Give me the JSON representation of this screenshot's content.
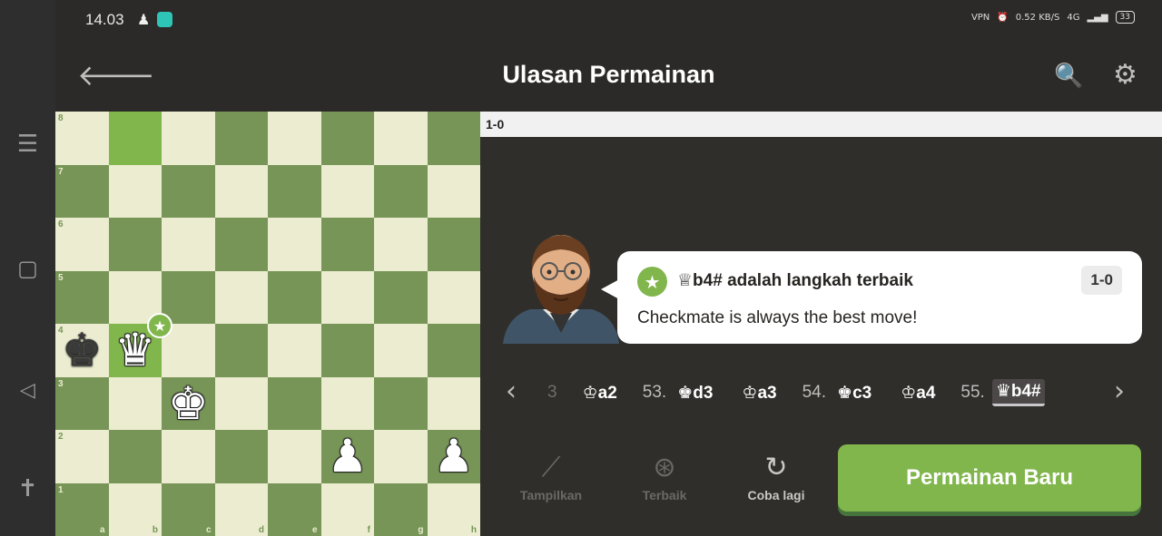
{
  "status": {
    "time": "14.03",
    "net_speed": "0.52 KB/S",
    "network": "4G",
    "battery": "33"
  },
  "header": {
    "title": "Ulasan Permainan",
    "back_icon": "arrow-left-icon",
    "analysis_icon": "magnifier-analysis-icon",
    "settings_icon": "gear-icon"
  },
  "board": {
    "ranks": [
      "8",
      "7",
      "6",
      "5",
      "4",
      "3",
      "2",
      "1"
    ],
    "files": [
      "a",
      "b",
      "c",
      "d",
      "e",
      "f",
      "g",
      "h"
    ],
    "highlight_squares": [
      "b8",
      "b4"
    ],
    "pieces": [
      {
        "square": "a4",
        "piece": "king",
        "color": "black",
        "glyph": "♚"
      },
      {
        "square": "b4",
        "piece": "queen",
        "color": "white",
        "glyph": "♛",
        "best": true
      },
      {
        "square": "c3",
        "piece": "king",
        "color": "white",
        "glyph": "♚"
      },
      {
        "square": "f2",
        "piece": "pawn",
        "color": "white",
        "glyph": "♟"
      },
      {
        "square": "h2",
        "piece": "pawn",
        "color": "white",
        "glyph": "♟"
      }
    ]
  },
  "panel": {
    "result": "1-0",
    "bubble": {
      "title_piece": "♕",
      "title_text": "b4# adalah langkah terbaik",
      "score": "1-0",
      "text": "Checkmate is always the best move!"
    },
    "moves": [
      {
        "num": "",
        "piece": "♔",
        "san": "a2"
      },
      {
        "num": "53.",
        "piece": "♚",
        "san": "d3"
      },
      {
        "num": "",
        "piece": "♔",
        "san": "a3"
      },
      {
        "num": "54.",
        "piece": "♚",
        "san": "c3"
      },
      {
        "num": "",
        "piece": "♔",
        "san": "a4"
      },
      {
        "num": "55.",
        "piece": "♛",
        "san": "b4#",
        "current": true
      }
    ],
    "tools": [
      {
        "label": "Tampilkan",
        "icon": "hint-icon",
        "glyph": "⟋",
        "enabled": false
      },
      {
        "label": "Terbaik",
        "icon": "best-move-icon",
        "glyph": "⊛",
        "enabled": false
      },
      {
        "label": "Coba lagi",
        "icon": "retry-icon",
        "glyph": "↻",
        "enabled": true
      }
    ],
    "new_game_label": "Permainan Baru"
  },
  "colors": {
    "light_square": "#ebecd0",
    "dark_square": "#779556",
    "highlight": "#81b64c",
    "accent": "#81b64c",
    "background": "#302e2b"
  }
}
